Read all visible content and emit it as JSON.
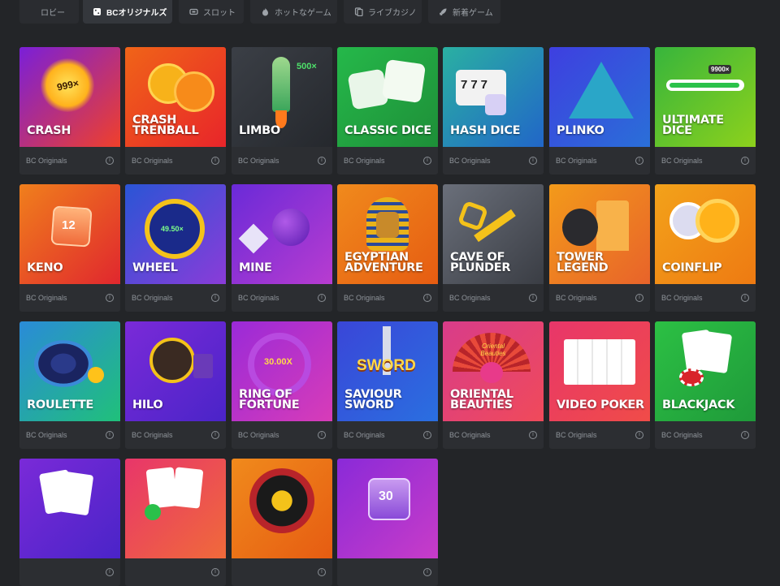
{
  "tabs": [
    {
      "label": "ロビー",
      "icon": "none",
      "active": false
    },
    {
      "label": "BCオリジナルズ",
      "icon": "dice-icon",
      "active": true
    },
    {
      "label": "スロット",
      "icon": "slot-icon",
      "active": false
    },
    {
      "label": "ホットなゲーム",
      "icon": "fire-icon",
      "active": false
    },
    {
      "label": "ライブカジノ",
      "icon": "cards-icon",
      "active": false
    },
    {
      "label": "新着ゲーム",
      "icon": "rocket-icon",
      "active": false
    }
  ],
  "games": [
    {
      "title": "CRASH",
      "provider": "BC Originals",
      "bg": [
        "#7a1fd8",
        "#f0402a"
      ],
      "art_text": "999×"
    },
    {
      "title": "CRASH\nTRENBALL",
      "provider": "BC Originals",
      "bg": [
        "#f06418",
        "#e8252a"
      ],
      "art_text": ""
    },
    {
      "title": "LIMBO",
      "provider": "BC Originals",
      "bg": [
        "#3b3f46",
        "#25282d"
      ],
      "art_text": "500×"
    },
    {
      "title": "CLASSIC DICE",
      "provider": "BC Originals",
      "bg": [
        "#25b84a",
        "#1e8f38"
      ],
      "art_text": ""
    },
    {
      "title": "HASH DICE",
      "provider": "BC Originals",
      "bg": [
        "#2ab0a2",
        "#2166c8"
      ],
      "art_text": "777"
    },
    {
      "title": "PLINKO",
      "provider": "BC Originals",
      "bg": [
        "#3e3fe0",
        "#2a6fd8"
      ],
      "art_text": ""
    },
    {
      "title": "ULTIMATE\nDICE",
      "provider": "BC Originals",
      "bg": [
        "#37b53c",
        "#8dd11c"
      ],
      "art_text": "9900×"
    },
    {
      "title": "KENO",
      "provider": "BC Originals",
      "bg": [
        "#f07f1c",
        "#e0272e"
      ],
      "art_text": "12"
    },
    {
      "title": "WHEEL",
      "provider": "BC Originals",
      "bg": [
        "#2a55d6",
        "#8a3cd8"
      ],
      "art_text": "49.50×"
    },
    {
      "title": "MINE",
      "provider": "BC Originals",
      "bg": [
        "#6a2ad8",
        "#b83cd0"
      ],
      "art_text": ""
    },
    {
      "title": "EGYPTIAN\nADVENTURE",
      "provider": "BC Originals",
      "bg": [
        "#f08a1c",
        "#e65c12"
      ],
      "art_text": ""
    },
    {
      "title": "CAVE OF\nPLUNDER",
      "provider": "BC Originals",
      "bg": [
        "#6a6f7a",
        "#3a3d44"
      ],
      "art_text": ""
    },
    {
      "title": "TOWER\nLEGEND",
      "provider": "BC Originals",
      "bg": [
        "#f39a1a",
        "#e8632a"
      ],
      "art_text": ""
    },
    {
      "title": "COINFLIP",
      "provider": "BC Originals",
      "bg": [
        "#f3a21a",
        "#ee7a12"
      ],
      "art_text": ""
    },
    {
      "title": "ROULETTE",
      "provider": "BC Originals",
      "bg": [
        "#2a8bd8",
        "#20c07a"
      ],
      "art_text": ""
    },
    {
      "title": "HILO",
      "provider": "BC Originals",
      "bg": [
        "#7a2ad8",
        "#4a24c8"
      ],
      "art_text": ""
    },
    {
      "title": "RING OF\nFORTUNE",
      "provider": "BC Originals",
      "bg": [
        "#9a2ad8",
        "#d83cb8"
      ],
      "art_text": "30.00X"
    },
    {
      "title": "SAVIOUR\nSWORD",
      "provider": "BC Originals",
      "bg": [
        "#3a46d8",
        "#2a6fe0"
      ],
      "art_text": "SWORD"
    },
    {
      "title": "ORIENTAL\nBEAUTIES",
      "provider": "BC Originals",
      "bg": [
        "#d83c8a",
        "#f04a5a"
      ],
      "art_text": "Oriental Beauties"
    },
    {
      "title": "VIDEO POKER",
      "provider": "BC Originals",
      "bg": [
        "#e8366a",
        "#f04c48"
      ],
      "art_text": ""
    },
    {
      "title": "BLACKJACK",
      "provider": "BC Originals",
      "bg": [
        "#2cc044",
        "#1f9a3a"
      ],
      "art_text": ""
    },
    {
      "title": "",
      "provider": "",
      "bg": [
        "#7a2ad8",
        "#4a24c8"
      ],
      "art_text": ""
    },
    {
      "title": "",
      "provider": "",
      "bg": [
        "#e8366a",
        "#f06a3a"
      ],
      "art_text": ""
    },
    {
      "title": "",
      "provider": "",
      "bg": [
        "#f08a1c",
        "#e65c12"
      ],
      "art_text": ""
    },
    {
      "title": "",
      "provider": "",
      "bg": [
        "#8a2ad8",
        "#c83cc8"
      ],
      "art_text": "30"
    }
  ]
}
